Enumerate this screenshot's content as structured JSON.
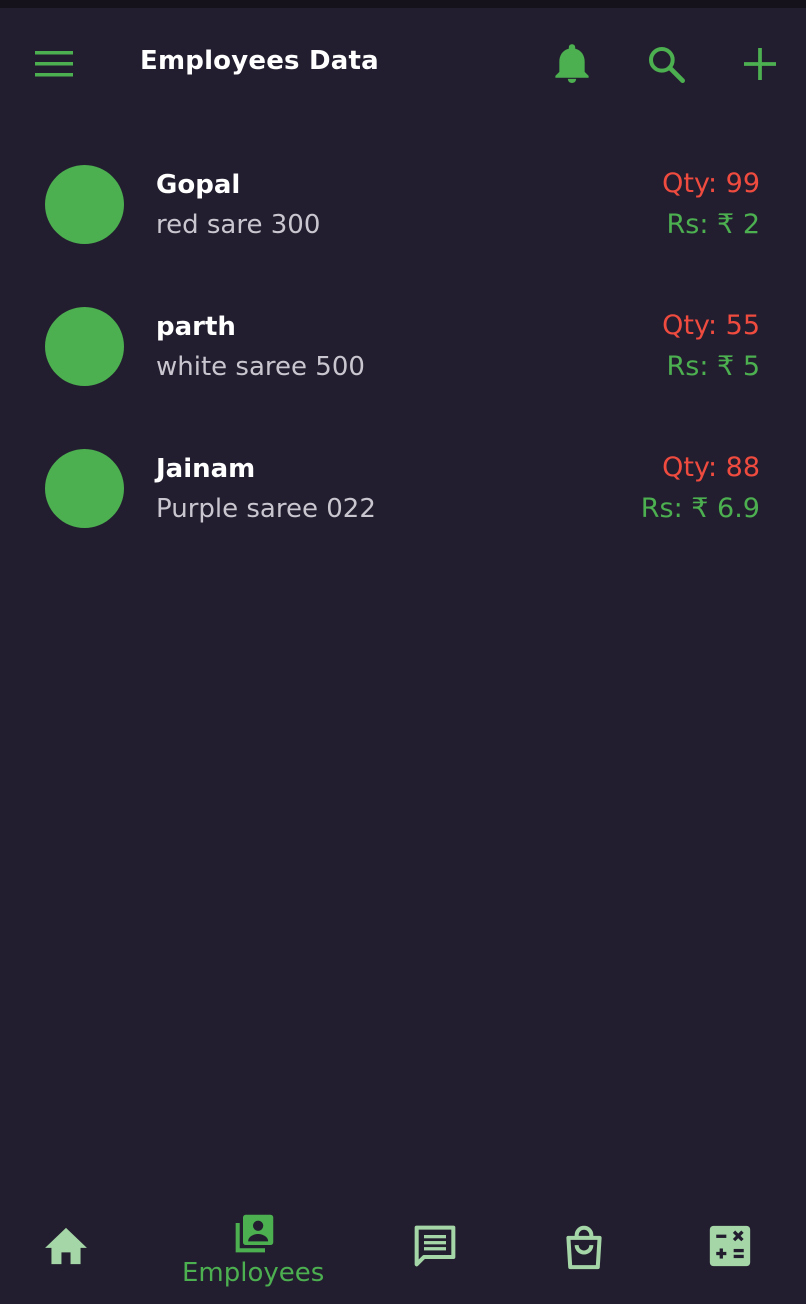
{
  "header": {
    "title": "Employees Data",
    "icons": [
      "menu-icon",
      "bell-icon",
      "search-icon",
      "add-icon"
    ]
  },
  "employees": [
    {
      "name": "Gopal",
      "description": "red sare 300",
      "qty": "Qty: 99",
      "price": "Rs: ₹ 2"
    },
    {
      "name": "parth",
      "description": "white saree 500",
      "qty": "Qty: 55",
      "price": "Rs: ₹ 5"
    },
    {
      "name": "Jainam",
      "description": "Purple saree 022",
      "qty": "Qty: 88",
      "price": "Rs: ₹ 6.9"
    }
  ],
  "bottom_nav": {
    "active_label": "Employees",
    "items": [
      "home-icon",
      "employees-icon",
      "messages-icon",
      "shopping-bag-icon",
      "calculator-icon"
    ]
  },
  "colors": {
    "background": "#231e2f",
    "accent": "#4caf50",
    "qty": "#ef4b3f",
    "icon_inactive": "#a5d6a7"
  }
}
